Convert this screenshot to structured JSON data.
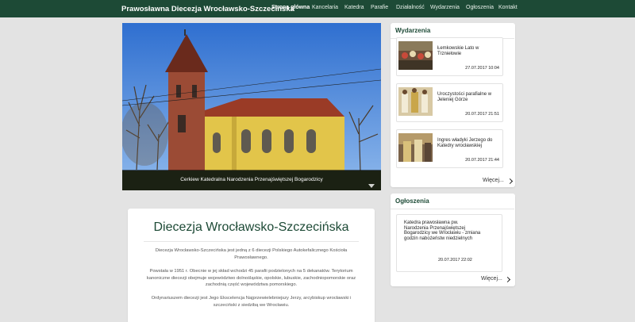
{
  "header": {
    "brand": "Prawosławna Diecezja Wrocławsko-Szczecińska",
    "nav": [
      "Strona główna",
      "Kancelaria",
      "Katedra",
      "Parafie",
      "Działalność",
      "Wydarzenia",
      "Ogłoszenia",
      "Kontakt"
    ],
    "active_item": "Strona główna",
    "background_color": "#1d4a36"
  },
  "hero": {
    "caption": "Cerkiew Katedralna Narodzenia Przenajświętszej Bogarodzicy"
  },
  "events": {
    "title": "Wydarzenia",
    "items": [
      {
        "title": "Łemkowskie Lato w Trzniełowie",
        "date": "27.07.2017 10:04"
      },
      {
        "title": "Uroczystości parafialne w Jeleniej Górze",
        "date": "20.07.2017 21:51"
      },
      {
        "title": "Ingres władyki Jerzego do Katedry wrocławskiej",
        "date": "20.07.2017 21:44"
      }
    ],
    "more_label": "Więcej..."
  },
  "announcements": {
    "title": "Ogłoszenia",
    "item_title": "Katedra prawosławna pw. Narodzenia Przenajświętszej Bogarodzicy we Wrocławiu - zmiana godzin nabożeństw niedzielnych",
    "item_date": "20.07.2017 22:02",
    "more_label": "Więcej..."
  },
  "main": {
    "title": "Diecezja Wrocławsko-Szczecińska",
    "paragraphs": [
      "Diecezja Wrocławsko-Szczecińska jest jedną z 6 diecezji Polskiego Autokefalicznego Kościoła Prawosławnego.",
      "Powstała w 1951 r. Obecnie w jej skład wchodzi 45 parafii podzielonych na 5 dekanatów. Terytorium kanoniczne diecezji obejmuje województwo dolnośląskie, opolskie, lubuskie, zachodniopomorskie oraz zachodnią część województwa pomorskiego.",
      "Ordynariuszem diecezji jest Jego Ekscelencja Najprzewielebniejszy Jerzy, arcybiskup wrocławski i szczeciński z siedzibą we Wrocławiu."
    ]
  }
}
